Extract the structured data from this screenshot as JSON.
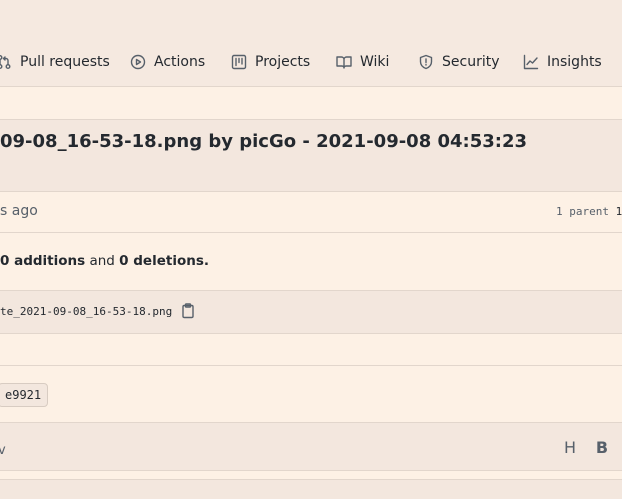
{
  "repo_nav": {
    "pull_requests": "Pull requests",
    "actions": "Actions",
    "projects": "Projects",
    "wiki": "Wiki",
    "security": "Security",
    "insights": "Insights"
  },
  "commit": {
    "title": "09-08_16-53-18.png by picGo - 2021-09-08 04:53:23",
    "time_ago": "s ago",
    "parent_label": "1 parent",
    "parent_sha": "1",
    "stats_additions": "0 additions",
    "stats_and": "and",
    "stats_deletions": "0 deletions.",
    "filename": "te_2021-09-08_16-53-18.png",
    "sha_badge": "e9921"
  },
  "comment_toolbar": {
    "partial_tab": "v",
    "heading_label": "H",
    "bold_label": "B"
  }
}
